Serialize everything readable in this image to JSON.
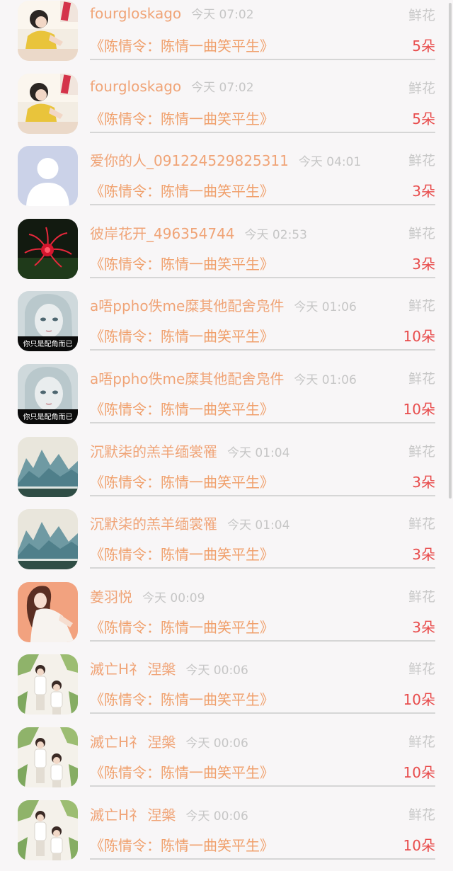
{
  "gift_records": [
    {
      "user": "fourgloskago",
      "time": "今天 07:02",
      "gift_type": "鲜花",
      "book": "《陈情令：陈情一曲笑平生》",
      "count": "5朵",
      "avatar": "girl-reading-avatar"
    },
    {
      "user": "fourgloskago",
      "time": "今天 07:02",
      "gift_type": "鲜花",
      "book": "《陈情令：陈情一曲笑平生》",
      "count": "5朵",
      "avatar": "girl-reading-avatar"
    },
    {
      "user": "爱你的人_091224529825311",
      "time": "今天 04:01",
      "gift_type": "鲜花",
      "book": "《陈情令：陈情一曲笑平生》",
      "count": "3朵",
      "avatar": "default-user-avatar"
    },
    {
      "user": "彼岸花开_496354744",
      "time": "今天 02:53",
      "gift_type": "鲜花",
      "book": "《陈情令：陈情一曲笑平生》",
      "count": "3朵",
      "avatar": "red-flower-avatar"
    },
    {
      "user": "a唔ppho佚me糜其他配舍凫件",
      "time": "今天 01:06",
      "gift_type": "鲜花",
      "book": "《陈情令：陈情一曲笑平生》",
      "count": "10朵",
      "avatar": "anime-girl-avatar"
    },
    {
      "user": "a唔ppho佚me糜其他配舍凫件",
      "time": "今天 01:06",
      "gift_type": "鲜花",
      "book": "《陈情令：陈情一曲笑平生》",
      "count": "10朵",
      "avatar": "anime-girl-avatar"
    },
    {
      "user": "沉默柒的羔羊缅裳罹",
      "time": "今天 01:04",
      "gift_type": "鲜花",
      "book": "《陈情令：陈情一曲笑平生》",
      "count": "3朵",
      "avatar": "landscape-avatar"
    },
    {
      "user": "沉默柒的羔羊缅裳罹",
      "time": "今天 01:04",
      "gift_type": "鲜花",
      "book": "《陈情令：陈情一曲笑平生》",
      "count": "3朵",
      "avatar": "landscape-avatar"
    },
    {
      "user": "姜羽悦",
      "time": "今天 00:09",
      "gift_type": "鲜花",
      "book": "《陈情令：陈情一曲笑平生》",
      "count": "3朵",
      "avatar": "woman-portrait-avatar"
    },
    {
      "user": "滅亡H礻 涅槃",
      "time": "今天 00:06",
      "gift_type": "鲜花",
      "book": "《陈情令：陈情一曲笑平生》",
      "count": "10朵",
      "avatar": "two-boys-avatar"
    },
    {
      "user": "滅亡H礻 涅槃",
      "time": "今天 00:06",
      "gift_type": "鲜花",
      "book": "《陈情令：陈情一曲笑平生》",
      "count": "10朵",
      "avatar": "two-boys-avatar"
    },
    {
      "user": "滅亡H礻 涅槃",
      "time": "今天 00:06",
      "gift_type": "鲜花",
      "book": "《陈情令：陈情一曲笑平生》",
      "count": "10朵",
      "avatar": "two-boys-avatar"
    }
  ],
  "avatar_captions": {
    "anime-girl-avatar": "你只是配角而已"
  },
  "colors": {
    "name": "#f0a477",
    "time": "#c6c6c6",
    "book_title": "#f0a06c",
    "count": "#e84b4b",
    "gift_type": "#c8c8c8"
  }
}
